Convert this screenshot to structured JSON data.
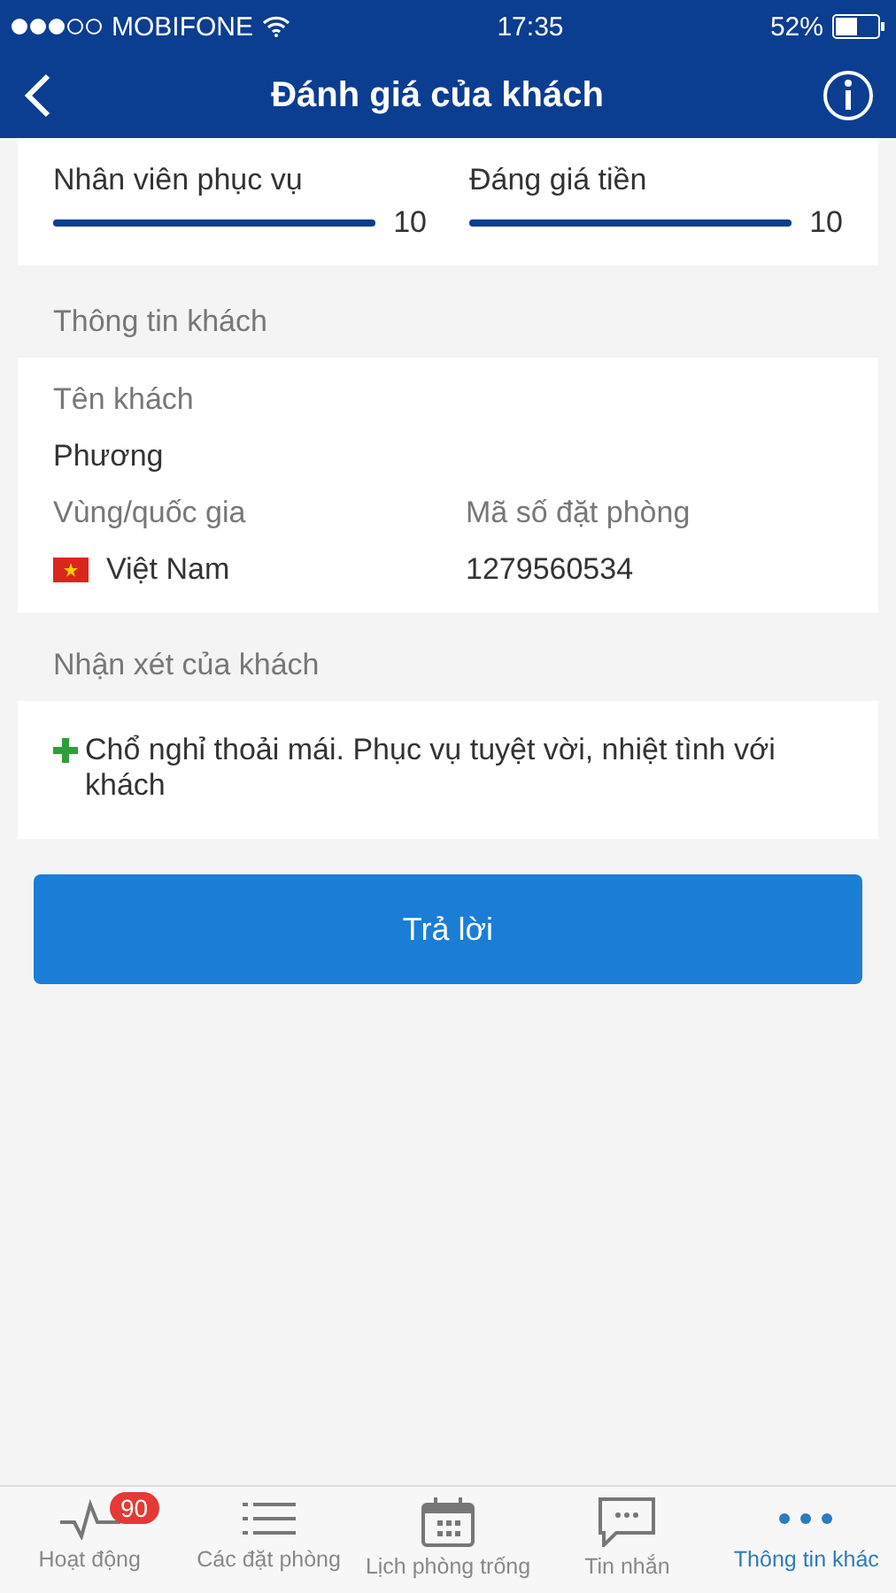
{
  "status_bar": {
    "carrier": "MOBIFONE",
    "time": "17:35",
    "battery": "52%"
  },
  "nav": {
    "title": "Đánh giá của khách"
  },
  "ratings": [
    {
      "label": "Nhân viên phục vụ",
      "level": 1,
      "value": "10"
    },
    {
      "label": "Đáng giá tiền",
      "level": 1,
      "value": "10"
    }
  ],
  "guest_info": {
    "heading": "Thông tin khách",
    "name_label": "Tên khách",
    "name": "Phương",
    "country_label": "Vùng/quốc gia",
    "country": "Việt Nam",
    "booking_label": "Mã số đặt phòng",
    "booking_number": "1279560534"
  },
  "review": {
    "heading": "Nhận xét của khách",
    "comments": [
      {
        "kind": "positive",
        "text": "Chổ nghỉ thoải mái. Phục vụ tuyệt vời, nhiệt tình với khách"
      }
    ]
  },
  "reply_button": "Trả lời",
  "tab_bar": [
    {
      "kind": "activity",
      "label": "Hoạt động",
      "badge": "90",
      "selected": false
    },
    {
      "kind": "list",
      "label": "Các đặt phòng",
      "selected": false
    },
    {
      "kind": "calendar",
      "label": "Lịch phòng trống",
      "selected": false
    },
    {
      "kind": "message",
      "label": "Tin nhắn",
      "selected": false
    },
    {
      "kind": "more",
      "label": "Thông tin khác",
      "selected": true
    }
  ]
}
